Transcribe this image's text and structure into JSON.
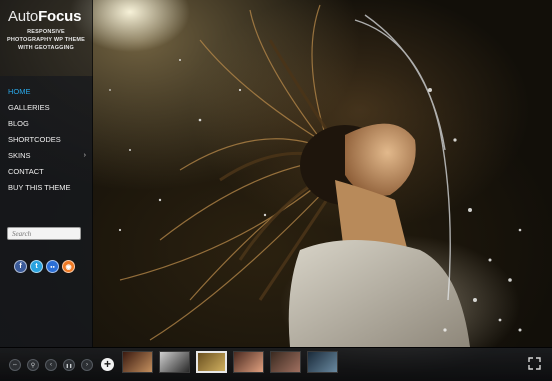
{
  "logo": {
    "part1": "Auto",
    "part2": "Focus"
  },
  "tagline": "Responsive photography WP theme with geotagging",
  "nav": {
    "items": [
      {
        "label": "HOME",
        "active": true
      },
      {
        "label": "GALLERIES"
      },
      {
        "label": "BLOG"
      },
      {
        "label": "SHORTCODES"
      },
      {
        "label": "SKINS",
        "submenu": true
      },
      {
        "label": "CONTACT"
      },
      {
        "label": "BUY THIS THEME"
      }
    ],
    "active_color": "#2aa8e8"
  },
  "search": {
    "placeholder": "Search"
  },
  "social": [
    {
      "icon": "facebook-icon",
      "glyph": "f",
      "color": "#3b5b9a"
    },
    {
      "icon": "twitter-icon",
      "glyph": "t",
      "color": "#29a3e0"
    },
    {
      "icon": "flickr-icon",
      "glyph": "●●",
      "color": "#2b6fd6"
    },
    {
      "icon": "rss-icon",
      "glyph": "◉",
      "color": "#f07a25"
    }
  ],
  "slideshow_controls": [
    {
      "icon": "fullscreen-icon",
      "glyph": "⇔"
    },
    {
      "icon": "location-pin-icon",
      "glyph": "⚲"
    },
    {
      "icon": "previous-icon",
      "glyph": "‹"
    },
    {
      "icon": "pause-icon",
      "glyph": "❚❚"
    },
    {
      "icon": "next-icon",
      "glyph": "›"
    }
  ],
  "thumbnails": [
    {
      "name": "thumbnail-1",
      "colors": [
        "#3a1a10",
        "#c4905f"
      ]
    },
    {
      "name": "thumbnail-2",
      "colors": [
        "#cfcfcf",
        "#2a2a2a"
      ]
    },
    {
      "name": "thumbnail-3",
      "colors": [
        "#6a5020",
        "#d0b060"
      ],
      "selected": true
    },
    {
      "name": "thumbnail-4",
      "colors": [
        "#4a2a20",
        "#e0a080"
      ]
    },
    {
      "name": "thumbnail-5",
      "colors": [
        "#3a2a20",
        "#a07060"
      ]
    },
    {
      "name": "thumbnail-6",
      "colors": [
        "#1a2a3a",
        "#6a8aa0"
      ]
    }
  ]
}
